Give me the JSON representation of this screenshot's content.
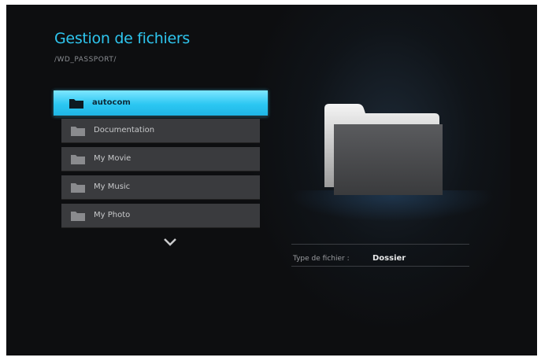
{
  "header": {
    "title": "Gestion de fichiers",
    "path": "/WD_PASSPORT/"
  },
  "file_list": {
    "items": [
      {
        "label": "autocom",
        "selected": true
      },
      {
        "label": "Documentation",
        "selected": false
      },
      {
        "label": "My Movie",
        "selected": false
      },
      {
        "label": "My Music",
        "selected": false
      },
      {
        "label": "My Photo",
        "selected": false
      }
    ],
    "scroll_icon": "chevron-down-icon"
  },
  "preview": {
    "icon": "folder-icon",
    "type_label": "Type de fichier :",
    "type_value": "Dossier"
  },
  "colors": {
    "accent": "#2ec5ee",
    "background": "#0d0e10",
    "item_bg": "#3a3b3e"
  }
}
